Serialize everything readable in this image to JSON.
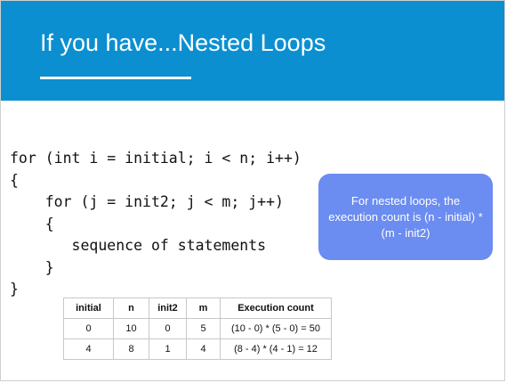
{
  "slide": {
    "title": "If you have...Nested Loops"
  },
  "code": {
    "lines": [
      "for (int i = initial; i < n; i++)",
      "{",
      "    for (j = init2; j < m; j++)",
      "    {",
      "       sequence of statements",
      "    }",
      "}"
    ]
  },
  "callout": {
    "text": "For nested loops, the execution count is (n - initial) * (m - init2)"
  },
  "table": {
    "headers": [
      "initial",
      "n",
      "init2",
      "m",
      "Execution count"
    ],
    "rows": [
      [
        "0",
        "10",
        "0",
        "5",
        "(10 - 0) * (5 - 0) = 50"
      ],
      [
        "4",
        "8",
        "1",
        "4",
        "(8 - 4) * (4 - 1) = 12"
      ]
    ]
  },
  "colors": {
    "header_bg": "#0b8fd1",
    "callout_bg": "#6b8cf0"
  }
}
